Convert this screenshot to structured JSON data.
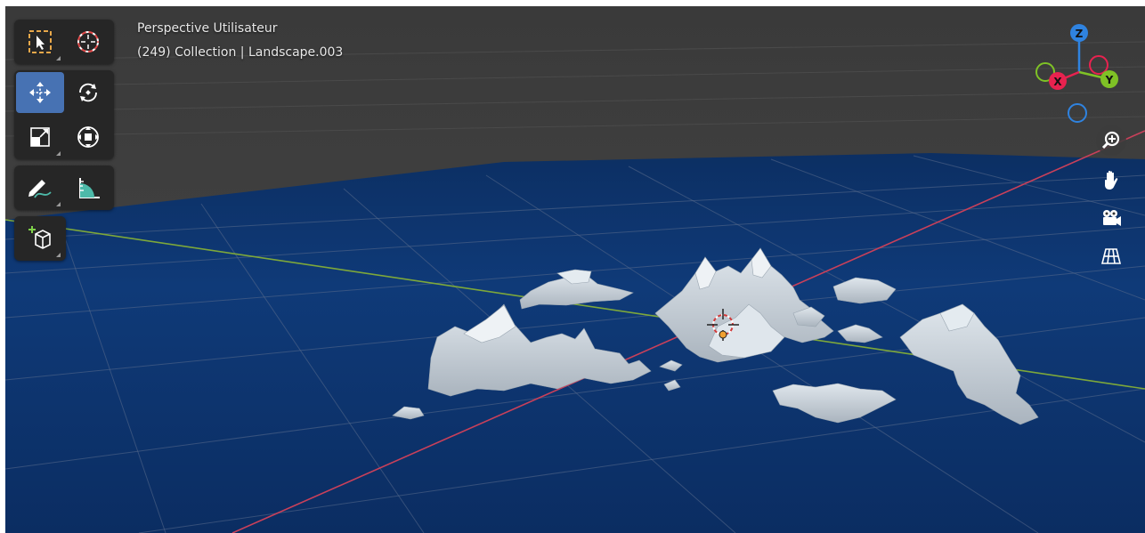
{
  "viewport": {
    "view_name": "Perspective Utilisateur",
    "context_info": "(249) Collection | Landscape.003"
  },
  "gizmo": {
    "axes": [
      {
        "label": "Z",
        "color": "#2f83e0"
      },
      {
        "label": "Y",
        "color": "#7fc226"
      },
      {
        "label": "X",
        "color": "#e8224f"
      }
    ]
  },
  "colors": {
    "viewport_bg": "#3d3d3d",
    "water": "#0f3a78",
    "terrain": "#c9d2da",
    "x_axis_line": "#c9405a",
    "y_axis_line": "#7ea83a",
    "active_tool": "#4772b3"
  },
  "toolbar": {
    "groups": [
      [
        "select-box-icon",
        "cursor-icon"
      ],
      [
        "move-icon",
        "rotate-icon",
        "scale-icon",
        "transform-icon"
      ],
      [
        "annotate-icon",
        "measure-icon"
      ],
      [
        "add-cube-icon"
      ]
    ],
    "active_tool": "move-icon"
  },
  "nav_controls": [
    "zoom-icon",
    "pan-hand-icon",
    "camera-icon",
    "grid-view-icon"
  ]
}
